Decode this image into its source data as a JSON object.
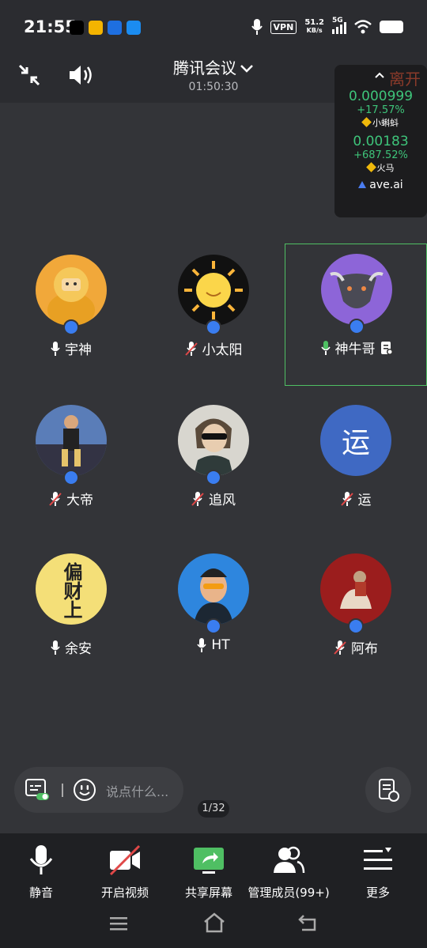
{
  "status": {
    "time": "21:55",
    "vpn": "VPN",
    "speed_top": "51.2",
    "speed_bottom": "KB/s",
    "network": "5G"
  },
  "header": {
    "title": "腾讯会议",
    "duration": "01:50:30"
  },
  "overlay": {
    "partial_text": "离开",
    "items": [
      {
        "value": "0.000999",
        "change": "+17.57%",
        "name": "小蝌蚪"
      },
      {
        "value": "0.00183",
        "change": "+687.52%",
        "name": "火马"
      }
    ],
    "source": "ave.ai"
  },
  "participants": [
    {
      "name": "宇神",
      "mic": "on"
    },
    {
      "name": "小太阳",
      "mic": "muted"
    },
    {
      "name": "神牛哥",
      "mic": "speaking",
      "active": true
    },
    {
      "name": "大帝",
      "mic": "muted"
    },
    {
      "name": "追风",
      "mic": "muted"
    },
    {
      "name": "运",
      "mic": "muted",
      "avatar_text": "运"
    },
    {
      "name": "余安",
      "mic": "on",
      "avatar_text": "偏财上"
    },
    {
      "name": "HT",
      "mic": "on"
    },
    {
      "name": "阿布",
      "mic": "muted"
    }
  ],
  "chat": {
    "placeholder": "说点什么..."
  },
  "pager": {
    "text": "1/32"
  },
  "toolbar": {
    "mute_label": "静音",
    "video_label": "开启视频",
    "share_label": "共享屏幕",
    "members_label": "管理成员(99+)",
    "more_label": "更多"
  },
  "colors": {
    "accent_blue": "#3a7df0",
    "active_green": "#4fbf63",
    "price_green": "#3ec47a"
  }
}
